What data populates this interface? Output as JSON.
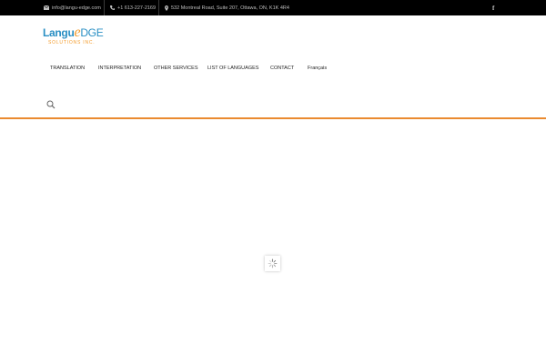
{
  "topbar": {
    "email": "info@langu-edge.com",
    "phone": "+1 613-227-2169",
    "address": "532 Montreal Road, Suite 207, Ottawa, ON, K1K 4R4",
    "facebook_glyph": "f"
  },
  "logo": {
    "part1": "Langu",
    "part2": "e",
    "part3": "DGE",
    "tagline": "SOLUTIONS INC."
  },
  "nav": {
    "items": [
      "TRANSLATION",
      "INTERPRETATION",
      "OTHER SERVICES",
      "LIST OF LANGUAGES",
      "CONTACT",
      "Français"
    ]
  },
  "icons": {
    "email": "envelope-icon",
    "phone": "phone-icon",
    "address": "map-marker-icon",
    "social": "facebook-icon",
    "search": "search-icon",
    "loader": "spinner-icon"
  },
  "colors": {
    "topbar_bg": "#000000",
    "brand_blue": "#2a8fc4",
    "brand_orange": "#f39c2d",
    "divider_orange": "#ea8a2f"
  }
}
